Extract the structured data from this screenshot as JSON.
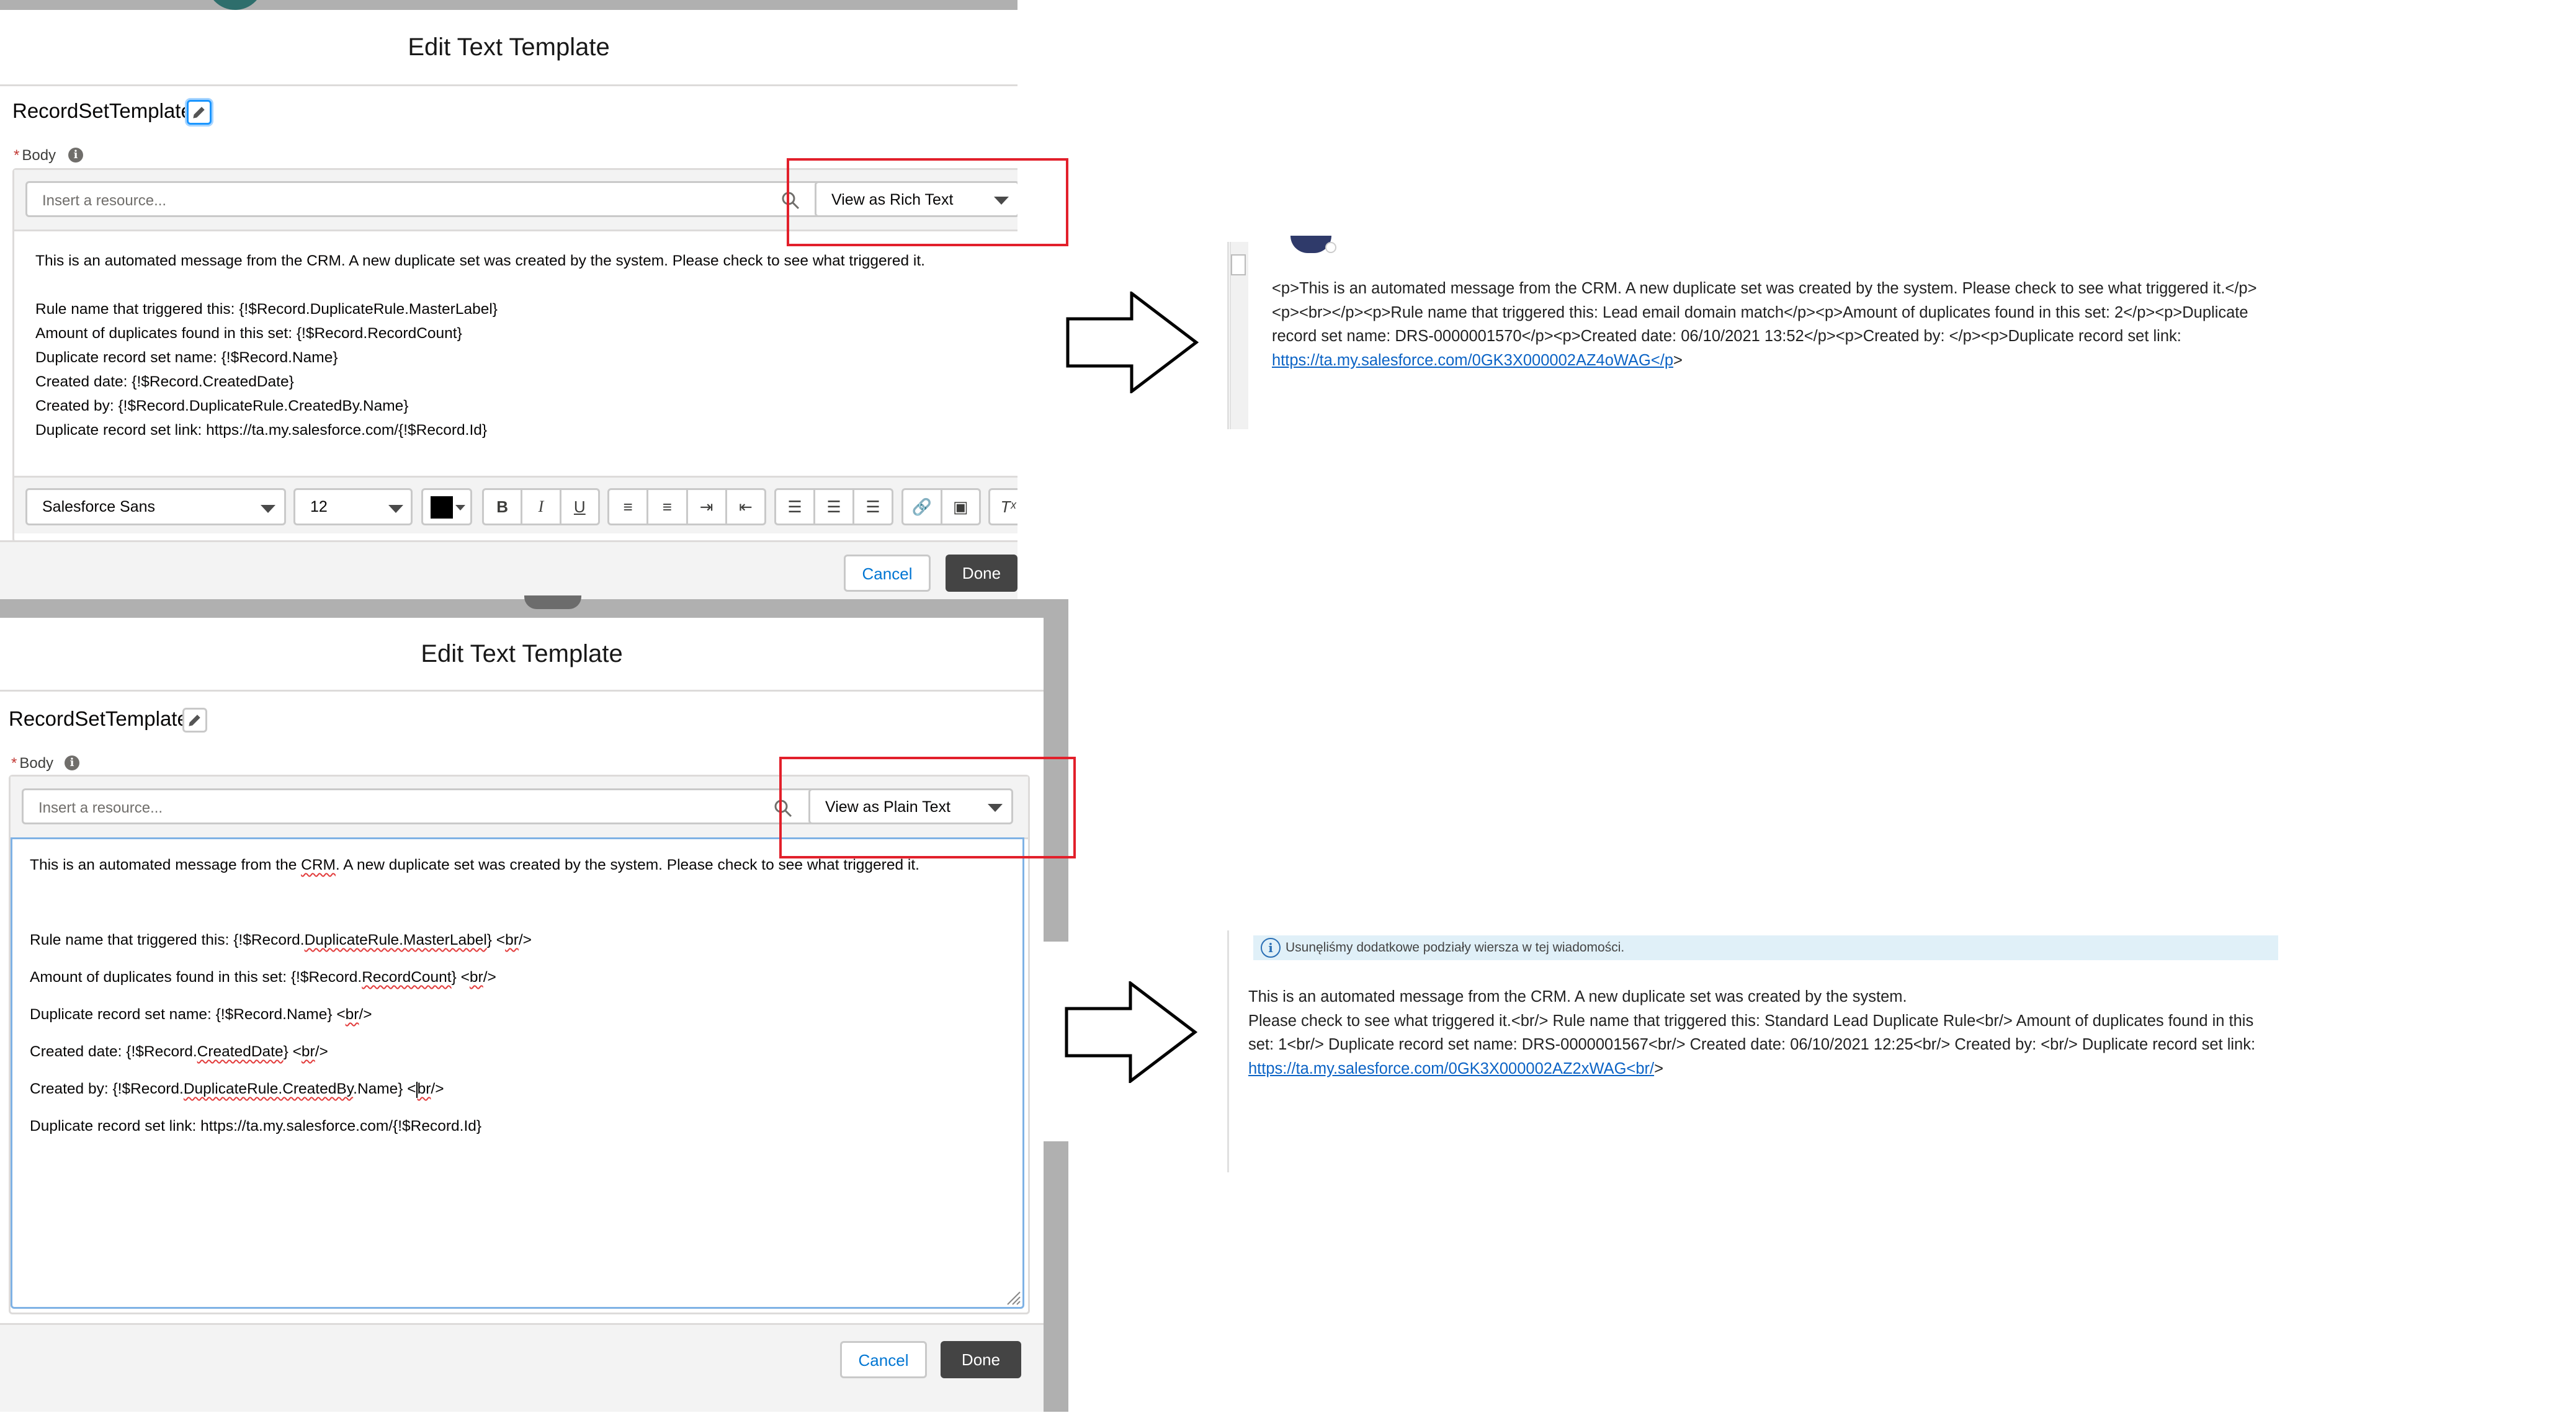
{
  "colors": {
    "accent_red": "#e2202b",
    "link_blue": "#0b63c5",
    "done_bg": "#444444",
    "avatar_teal": "#2e6e6c"
  },
  "top_panel": {
    "title": "Edit Text Template",
    "template_name": "RecordSetTemplate",
    "body_label": "Body",
    "resource_placeholder": "Insert a resource...",
    "view_mode": "View as Rich Text",
    "lines": [
      "This is an automated message from the CRM. A new duplicate set was created by the system. Please check to see what triggered it.",
      "",
      "Rule name that triggered this: {!$Record.DuplicateRule.MasterLabel}",
      "Amount of duplicates found in this set: {!$Record.RecordCount}",
      "Duplicate record set name: {!$Record.Name}",
      "Created date: {!$Record.CreatedDate}",
      "Created by: {!$Record.DuplicateRule.CreatedBy.Name}",
      "Duplicate record set link: https://ta.my.salesforce.com/{!$Record.Id}"
    ],
    "font_family": "Salesforce Sans",
    "font_size": "12",
    "toolbar_buttons": [
      "B",
      "I",
      "U"
    ],
    "cancel_label": "Cancel",
    "done_label": "Done"
  },
  "bottom_panel": {
    "title": "Edit Text Template",
    "template_name": "RecordSetTemplate",
    "body_label": "Body",
    "resource_placeholder": "Insert a resource...",
    "view_mode": "View as Plain Text",
    "lines": {
      "l1a": "This is an automated message from the ",
      "l1b": "CRM",
      "l1c": ". A new duplicate set was created by the system. Please check to see what triggered it.",
      "l2a": "Rule name that triggered this: {!$Record.",
      "l2b": "DuplicateRule.MasterLabel",
      "l2c": "}  <",
      "l2d": "br",
      "l2e": "/>",
      "l3a": "Amount of duplicates found in this set: {!$Record.",
      "l3b": "RecordCount",
      "l3c": "}  <",
      "l3d": "br",
      "l3e": "/>",
      "l4a": "Duplicate record set name: {!$Record.Name}  <",
      "l4b": "br",
      "l4c": "/>",
      "l5a": "Created date: {!$Record.",
      "l5b": "CreatedDate",
      "l5c": "}  <",
      "l5d": "br",
      "l5e": "/>",
      "l6a": "Created by: {!$Record.",
      "l6b": "DuplicateRule.CreatedBy",
      "l6c": ".Name} <",
      "l6d": "br",
      "l6e": "/>",
      "l7": "Duplicate record set link: https://ta.my.salesforce.com/{!$Record.Id}"
    },
    "cancel_label": "Cancel",
    "done_label": "Done"
  },
  "email_rich": {
    "text": "<p>This is an automated message from the CRM. A new duplicate set was created by the system. Please check to see what triggered it.</p><p><br></p><p>Rule name that triggered this: Lead email domain match</p><p>Amount of duplicates found in this set: 2</p><p>Duplicate record set name: DRS-0000001570</p><p>Created date: 06/10/2021 13:52</p><p>Created by: </p><p>Duplicate record set link: ",
    "link": "https://ta.my.salesforce.com/0GK3X000002AZ4oWAG</p",
    "tail": ">"
  },
  "email_plain": {
    "info_bar": "Usunęliśmy dodatkowe podziały wiersza w tej wiadomości.",
    "line1": "This is an automated message from the CRM. A new duplicate set was created by the system.",
    "text": "Please check to see what triggered it.<br/> Rule name that triggered this: Standard Lead Duplicate Rule<br/> Amount of duplicates found in this set: 1<br/> Duplicate record set name: DRS-0000001567<br/> Created date: 06/10/2021 12:25<br/> Created by: <br/> Duplicate record set link: ",
    "link": "https://ta.my.salesforce.com/0GK3X000002AZ2xWAG<br/",
    "tail": ">"
  }
}
